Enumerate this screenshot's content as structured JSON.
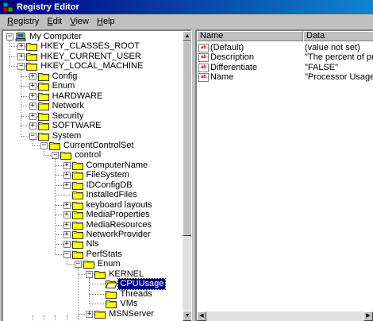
{
  "window": {
    "title": "Registry Editor"
  },
  "menu": [
    {
      "label": "Registry",
      "accel": "R",
      "rest": "egistry"
    },
    {
      "label": "Edit",
      "accel": "E",
      "rest": "dit"
    },
    {
      "label": "View",
      "accel": "V",
      "rest": "iew"
    },
    {
      "label": "Help",
      "accel": "H",
      "rest": "elp"
    }
  ],
  "tree": [
    {
      "label": "My Computer",
      "expander": "-",
      "icon": "computer-icon"
    },
    {
      "label": "HKEY_CLASSES_ROOT",
      "expander": "+",
      "icon": "folder-icon"
    },
    {
      "label": "HKEY_CURRENT_USER",
      "expander": "+",
      "icon": "folder-icon"
    },
    {
      "label": "HKEY_LOCAL_MACHINE",
      "expander": "-",
      "icon": "folder-icon"
    },
    {
      "label": "Config",
      "expander": "+",
      "icon": "folder-icon"
    },
    {
      "label": "Enum",
      "expander": "+",
      "icon": "folder-icon"
    },
    {
      "label": "HARDWARE",
      "expander": "+",
      "icon": "folder-icon"
    },
    {
      "label": "Network",
      "expander": "+",
      "icon": "folder-icon"
    },
    {
      "label": "Security",
      "expander": "+",
      "icon": "folder-icon"
    },
    {
      "label": "SOFTWARE",
      "expander": "+",
      "icon": "folder-icon"
    },
    {
      "label": "System",
      "expander": "-",
      "icon": "folder-icon"
    },
    {
      "label": "CurrentControlSet",
      "expander": "-",
      "icon": "folder-icon"
    },
    {
      "label": "control",
      "expander": "-",
      "icon": "folder-icon"
    },
    {
      "label": "ComputerName",
      "expander": "+",
      "icon": "folder-icon"
    },
    {
      "label": "FileSystem",
      "expander": "+",
      "icon": "folder-icon"
    },
    {
      "label": "IDConfigDB",
      "expander": "+",
      "icon": "folder-icon"
    },
    {
      "label": "InstalledFiles",
      "expander": "",
      "icon": "folder-icon"
    },
    {
      "label": "keyboard layouts",
      "expander": "+",
      "icon": "folder-icon"
    },
    {
      "label": "MediaProperties",
      "expander": "+",
      "icon": "folder-icon"
    },
    {
      "label": "MediaResources",
      "expander": "+",
      "icon": "folder-icon"
    },
    {
      "label": "NetworkProvider",
      "expander": "+",
      "icon": "folder-icon"
    },
    {
      "label": "Nls",
      "expander": "+",
      "icon": "folder-icon"
    },
    {
      "label": "PerfStats",
      "expander": "-",
      "icon": "folder-icon"
    },
    {
      "label": "Enum",
      "expander": "-",
      "icon": "folder-icon"
    },
    {
      "label": "KERNEL",
      "expander": "-",
      "icon": "folder-icon"
    },
    {
      "label": "CPUUsage",
      "expander": "",
      "icon": "open-folder-icon",
      "selected": true
    },
    {
      "label": "Threads",
      "expander": "",
      "icon": "folder-icon"
    },
    {
      "label": "VMs",
      "expander": "",
      "icon": "folder-icon"
    },
    {
      "label": "MSNServer",
      "expander": "+",
      "icon": "folder-icon"
    }
  ],
  "list": {
    "columns": [
      {
        "label": "Name"
      },
      {
        "label": "Data"
      }
    ],
    "rows": [
      {
        "name": "(Default)",
        "data": "(value not set)",
        "icon": "string-value-icon"
      },
      {
        "name": "Description",
        "data": "\"The percent of proces",
        "icon": "string-value-icon"
      },
      {
        "name": "Differentiate",
        "data": "\"FALSE\"",
        "icon": "string-value-icon"
      },
      {
        "name": "Name",
        "data": "\"Processor Usage (%)\"",
        "icon": "string-value-icon"
      }
    ],
    "value_icon_text": "ab"
  },
  "colors": {
    "titlebar": "#000080",
    "selection": "#000080",
    "folder": "#ffff00"
  }
}
